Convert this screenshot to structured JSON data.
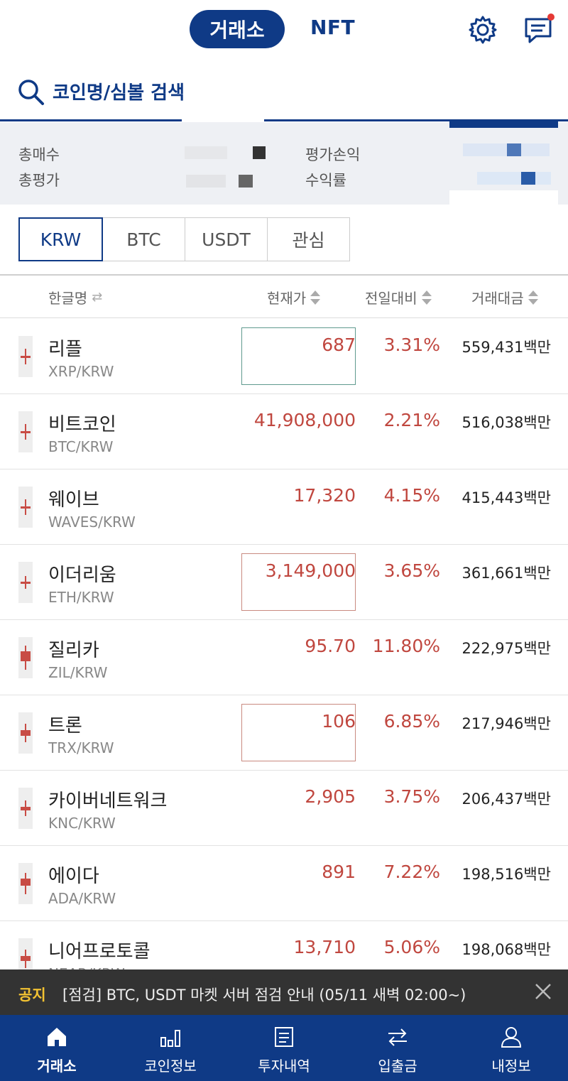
{
  "header": {
    "tab_exchange": "거래소",
    "tab_nft": "NFT",
    "icons": [
      "gear-icon",
      "chat-icon"
    ],
    "accent": "#0f3a86",
    "notification_dot": "#e53935"
  },
  "search": {
    "placeholder": "코인명/심볼 검색",
    "icon": "search-icon"
  },
  "summary": {
    "total_buy_label": "총매수",
    "total_eval_label": "총평가",
    "pnl_label": "평가손익",
    "return_label": "수익률"
  },
  "market_tabs": [
    "KRW",
    "BTC",
    "USDT",
    "관심"
  ],
  "columns": {
    "name": "한글명",
    "price": "현재가",
    "change": "전일대비",
    "volume": "거래대금"
  },
  "rows": [
    {
      "name": "리플",
      "symbol": "XRP/KRW",
      "price": "687",
      "change": "3.31%",
      "volume": "559,431백만"
    },
    {
      "name": "비트코인",
      "symbol": "BTC/KRW",
      "price": "41,908,000",
      "change": "2.21%",
      "volume": "516,038백만"
    },
    {
      "name": "웨이브",
      "symbol": "WAVES/KRW",
      "price": "17,320",
      "change": "4.15%",
      "volume": "415,443백만"
    },
    {
      "name": "이더리움",
      "symbol": "ETH/KRW",
      "price": "3,149,000",
      "change": "3.65%",
      "volume": "361,661백만"
    },
    {
      "name": "질리카",
      "symbol": "ZIL/KRW",
      "price": "95.70",
      "change": "11.80%",
      "volume": "222,975백만"
    },
    {
      "name": "트론",
      "symbol": "TRX/KRW",
      "price": "106",
      "change": "6.85%",
      "volume": "217,946백만"
    },
    {
      "name": "카이버네트워크",
      "symbol": "KNC/KRW",
      "price": "2,905",
      "change": "3.75%",
      "volume": "206,437백만"
    },
    {
      "name": "에이다",
      "symbol": "ADA/KRW",
      "price": "891",
      "change": "7.22%",
      "volume": "198,516백만"
    },
    {
      "name": "니어프로토콜",
      "symbol": "NEAR/KRW",
      "price": "13,710",
      "change": "5.06%",
      "volume": "198,068백만"
    }
  ],
  "notice": {
    "tag": "공지",
    "text": "[점검] BTC, USDT 마켓 서버 점검 안내 (05/11 새벽 02:00~)"
  },
  "bottom_nav": [
    {
      "label": "거래소",
      "icon": "home-icon"
    },
    {
      "label": "코인정보",
      "icon": "chart-icon"
    },
    {
      "label": "투자내역",
      "icon": "list-icon"
    },
    {
      "label": "입출금",
      "icon": "transfer-icon"
    },
    {
      "label": "내정보",
      "icon": "person-icon"
    }
  ],
  "colors": {
    "up": "#c0473f",
    "brand": "#0f3a86"
  }
}
